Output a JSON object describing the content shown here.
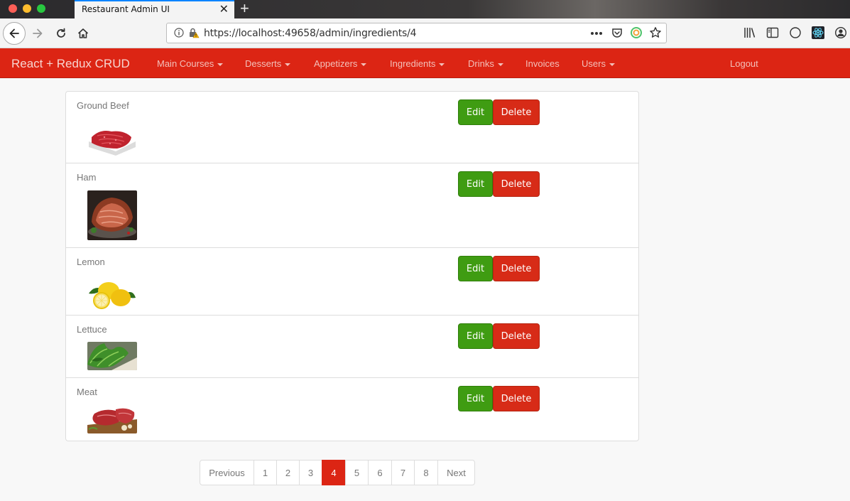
{
  "browser": {
    "tab_title": "Restaurant Admin UI",
    "url": "https://localhost:49658/admin/ingredients/4"
  },
  "app": {
    "brand": "React + Redux CRUD",
    "nav": [
      {
        "label": "Main Courses",
        "dropdown": true
      },
      {
        "label": "Desserts",
        "dropdown": true
      },
      {
        "label": "Appetizers",
        "dropdown": true
      },
      {
        "label": "Ingredients",
        "dropdown": true
      },
      {
        "label": "Drinks",
        "dropdown": true
      },
      {
        "label": "Invoices",
        "dropdown": false
      },
      {
        "label": "Users",
        "dropdown": true
      }
    ],
    "logout": "Logout"
  },
  "ingredients": [
    {
      "name": "Ground Beef",
      "image": "ground-beef-photo"
    },
    {
      "name": "Ham",
      "image": "ham-photo"
    },
    {
      "name": "Lemon",
      "image": "lemon-photo"
    },
    {
      "name": "Lettuce",
      "image": "lettuce-photo"
    },
    {
      "name": "Meat",
      "image": "meat-photo"
    }
  ],
  "actions": {
    "edit": "Edit",
    "delete": "Delete"
  },
  "pagination": {
    "previous": "Previous",
    "pages": [
      "1",
      "2",
      "3",
      "4",
      "5",
      "6",
      "7",
      "8"
    ],
    "current": "4",
    "next": "Next"
  },
  "colors": {
    "brand_red": "#dc2514",
    "edit_green": "#3f9c12",
    "delete_red": "#d72b17"
  }
}
